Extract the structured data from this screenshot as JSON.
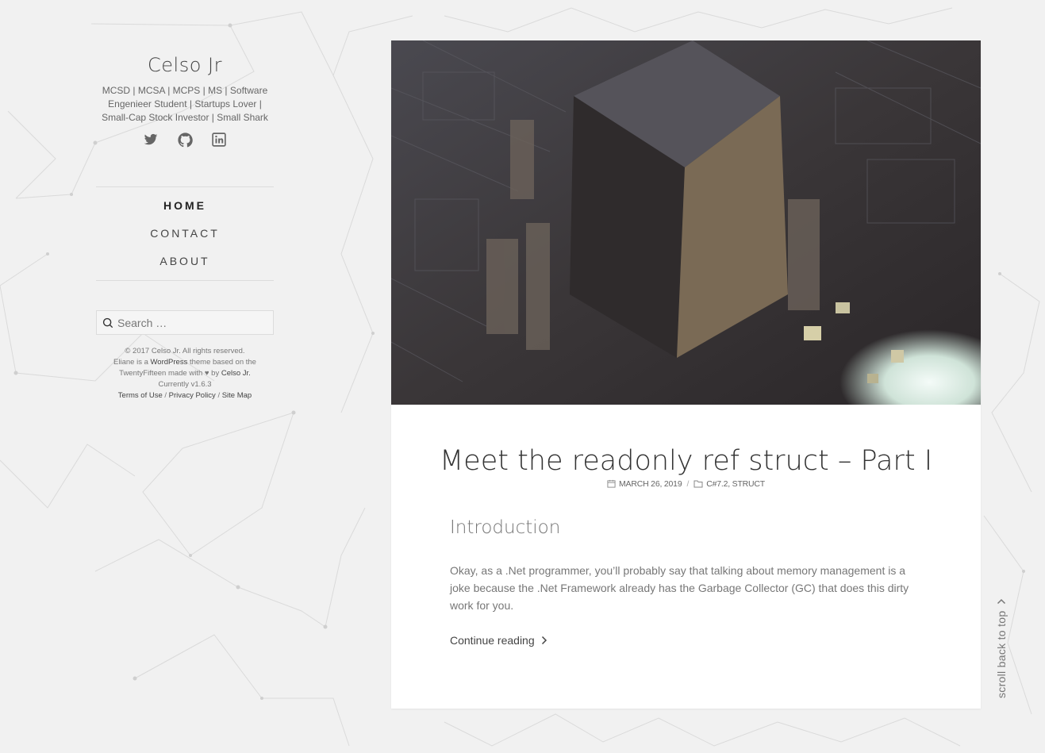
{
  "site": {
    "title": "Celso Jr",
    "description": "MCSD | MCSA | MCPS | MS | Software Engenieer Student | Startups Lover | Small-Cap Stock Investor | Small Shark",
    "social": [
      "twitter-icon",
      "github-icon",
      "linkedin-icon"
    ]
  },
  "nav": {
    "items": [
      {
        "label": "HOME"
      },
      {
        "label": "CONTACT"
      },
      {
        "label": "ABOUT"
      }
    ]
  },
  "search": {
    "placeholder": "Search …"
  },
  "footer": {
    "copyright": "© 2017 Celso Jr. All rights reserved.",
    "theme_prefix": "Eliane is a",
    "wordpress": "WordPress",
    "theme_mid": "theme based on the TwentyFifteen made with ♥ by",
    "author": "Celso Jr.",
    "version": "Currently v1.6.3",
    "terms": "Terms of Use",
    "privacy": "Privacy Policy",
    "sitemap": "Site Map",
    "sep": "/"
  },
  "post": {
    "title": "Meet the readonly ref struct – Part I",
    "date": "MARCH 26, 2019",
    "categories": "C#7.2, STRUCT",
    "subheading": "Introduction",
    "excerpt": "Okay, as a .Net programmer, you’ll probably say that talking about memory management is a joke because the .Net Framework already has the Garbage Collector (GC) that does this dirty work for you.",
    "continue": "Continue reading"
  },
  "scroll_top": "scroll back to top",
  "colors": {
    "background": "#f1f1f1",
    "card": "#ffffff",
    "text": "#333333",
    "muted": "#777777"
  }
}
